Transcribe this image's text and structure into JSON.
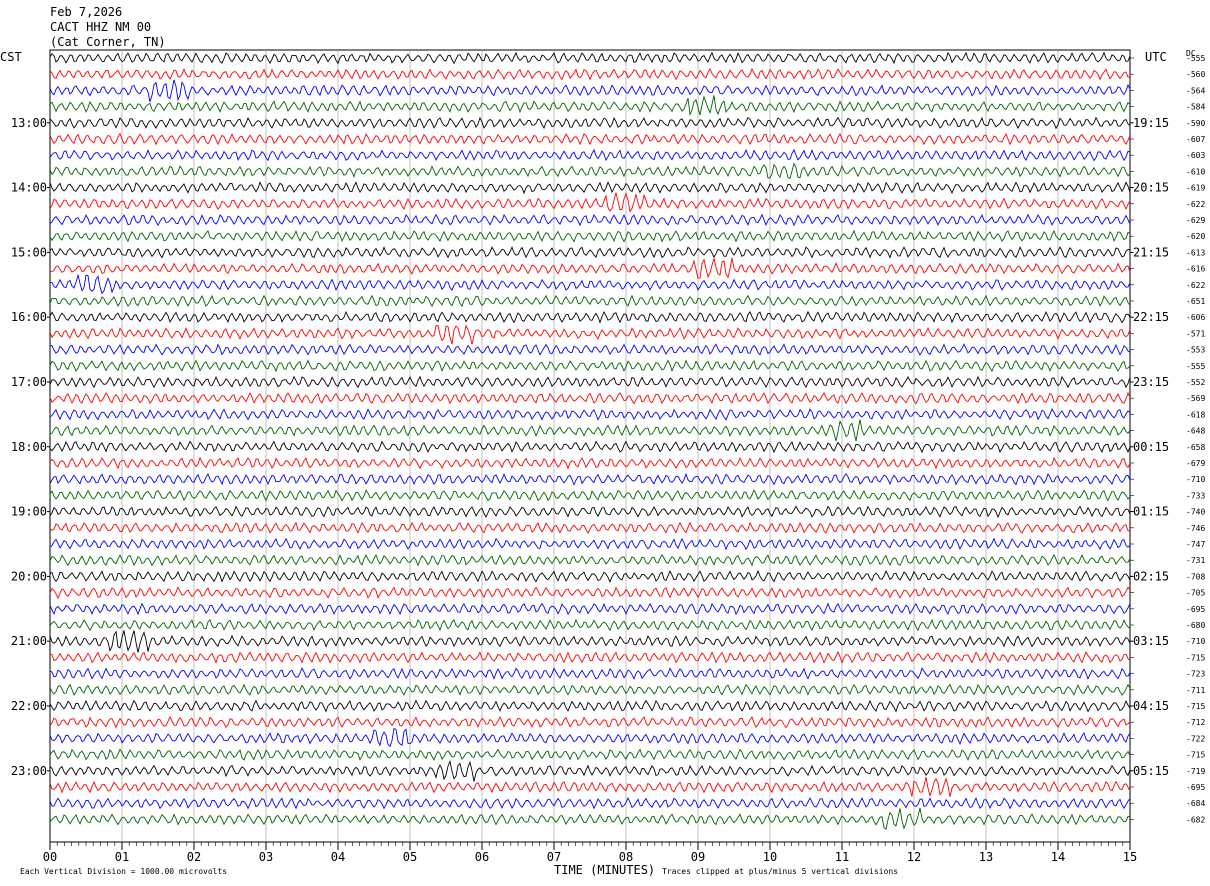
{
  "header": {
    "date": "Feb 7,2026",
    "station": "CACT HHZ NM 00",
    "location": "(Cat Corner, TN)"
  },
  "left_timezone": "CST",
  "right_timezone": "UTC",
  "dc_label": "DC",
  "footer": {
    "left": "Each Vertical Division = 1000.00 microvolts",
    "center": "TIME (MINUTES)",
    "right": "Traces clipped at plus/minus 5 vertical divisions"
  },
  "colors": {
    "trace_cycle": [
      "#000000",
      "#ff0000",
      "#0000ff",
      "#006400"
    ]
  },
  "chart_data": {
    "type": "line",
    "title": "",
    "xlabel": "TIME (MINUTES)",
    "xlim": [
      0,
      15
    ],
    "x_ticks": [
      "00",
      "01",
      "02",
      "03",
      "04",
      "05",
      "06",
      "07",
      "08",
      "09",
      "10",
      "11",
      "12",
      "13",
      "14",
      "15"
    ],
    "rows_per_hour": 4,
    "row_minutes": 15,
    "left_hour_labels": [
      "13:00",
      "14:00",
      "15:00",
      "16:00",
      "17:00",
      "18:00",
      "19:00",
      "20:00",
      "21:00",
      "22:00",
      "23:00"
    ],
    "right_hour_labels": [
      "19:15",
      "20:15",
      "21:15",
      "22:15",
      "23:15",
      "00:15",
      "01:15",
      "02:15",
      "03:15",
      "04:15",
      "05:15"
    ],
    "dc_offsets": [
      -555,
      -560,
      -564,
      -584,
      -590,
      -607,
      -603,
      -610,
      -619,
      -622,
      -629,
      -620,
      -613,
      -616,
      -622,
      -651,
      -606,
      -571,
      -553,
      -555,
      -552,
      -569,
      -618,
      -648,
      -658,
      -679,
      -710,
      -733,
      -740,
      -746,
      -747,
      -731,
      -708,
      -705,
      -695,
      -680,
      -710,
      -715,
      -723,
      -711,
      -715,
      -712,
      -722,
      -715,
      -719,
      -695,
      -684,
      -682
    ]
  }
}
